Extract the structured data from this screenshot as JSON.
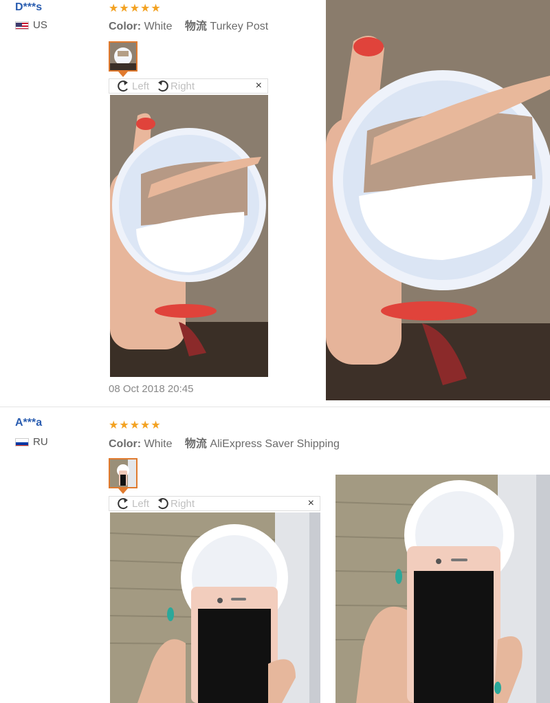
{
  "reviews": [
    {
      "user": "D***s",
      "country": "US",
      "stars": "★★★★★",
      "color_label": "Color:",
      "color_value": "White",
      "shipping_label": "物流",
      "shipping_value": "Turkey Post",
      "viewer": {
        "left_label": "Left",
        "right_label": "Right",
        "close": "×"
      },
      "date": "08 Oct 2018 20:45"
    },
    {
      "user": "A***a",
      "country": "RU",
      "stars": "★★★★★",
      "color_label": "Color:",
      "color_value": "White",
      "shipping_label": "物流",
      "shipping_value": "AliExpress Saver Shipping",
      "viewer": {
        "left_label": "Left",
        "right_label": "Right",
        "close": "×"
      }
    }
  ],
  "colors": {
    "username": "#2a5db0",
    "star": "#f3a222",
    "thumb_border": "#e07a2e"
  }
}
